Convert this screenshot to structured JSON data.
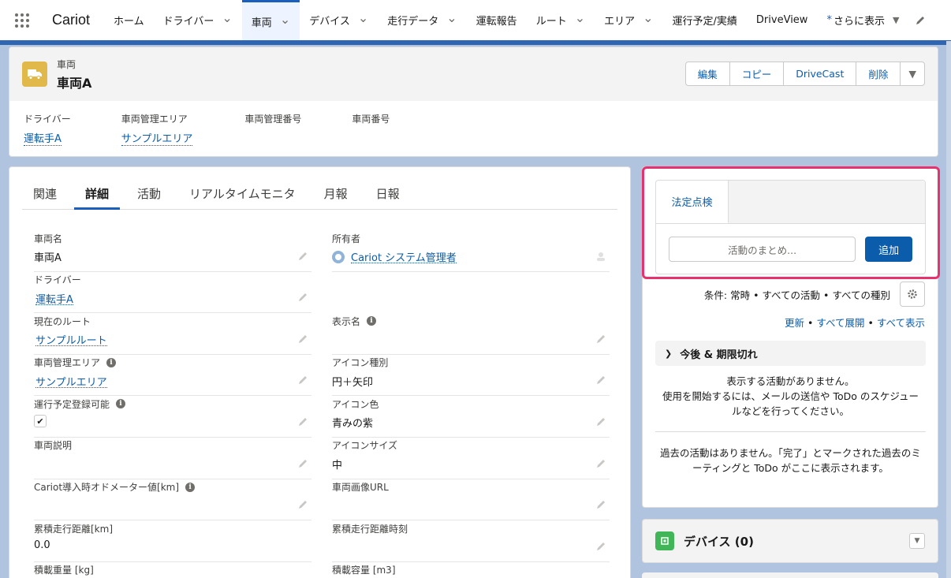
{
  "nav": {
    "app_name": "Cariot",
    "items": [
      {
        "label": "ホーム",
        "chevron": false,
        "active": false
      },
      {
        "label": "ドライバー",
        "chevron": true,
        "active": false
      },
      {
        "label": "車両",
        "chevron": true,
        "active": true
      },
      {
        "label": "デバイス",
        "chevron": true,
        "active": false
      },
      {
        "label": "走行データ",
        "chevron": true,
        "active": false
      },
      {
        "label": "運転報告",
        "chevron": false,
        "active": false
      },
      {
        "label": "ルート",
        "chevron": true,
        "active": false
      },
      {
        "label": "エリア",
        "chevron": true,
        "active": false
      },
      {
        "label": "運行予定/実績",
        "chevron": false,
        "active": false
      },
      {
        "label": "DriveView",
        "chevron": false,
        "active": false
      }
    ],
    "more_label": "さらに表示",
    "more_star": "*"
  },
  "record": {
    "object_label": "車両",
    "name": "車両A",
    "icon_color": "#e0b94a",
    "actions": [
      "編集",
      "コピー",
      "DriveCast",
      "削除"
    ],
    "highlights": [
      {
        "label": "ドライバー",
        "value": "運転手A"
      },
      {
        "label": "車両管理エリア",
        "value": "サンプルエリア"
      },
      {
        "label": "車両管理番号",
        "value": ""
      },
      {
        "label": "車両番号",
        "value": ""
      }
    ]
  },
  "detail": {
    "tabs": [
      "関連",
      "詳細",
      "活動",
      "リアルタイムモニタ",
      "月報",
      "日報"
    ],
    "active_tab": "詳細",
    "fields": {
      "vehicle_name": {
        "label": "車両名",
        "value": "車両A"
      },
      "owner": {
        "label": "所有者",
        "value": "Cariot システム管理者"
      },
      "driver": {
        "label": "ドライバー",
        "value": "運転手A"
      },
      "current_route": {
        "label": "現在のルート",
        "value": "サンプルルート"
      },
      "display_name": {
        "label": "表示名",
        "value": ""
      },
      "area": {
        "label": "車両管理エリア",
        "value": "サンプルエリア"
      },
      "icon_type": {
        "label": "アイコン種別",
        "value": "円＋矢印"
      },
      "schedulable": {
        "label": "運行予定登録可能",
        "checked": true
      },
      "icon_color": {
        "label": "アイコン色",
        "value": "青みの紫"
      },
      "vehicle_desc": {
        "label": "車両説明",
        "value": ""
      },
      "icon_size": {
        "label": "アイコンサイズ",
        "value": "中"
      },
      "odometer": {
        "label": "Cariot導入時オドメーター値[km]",
        "value": ""
      },
      "image_url": {
        "label": "車両画像URL",
        "value": ""
      },
      "total_distance": {
        "label": "累積走行距離[km]",
        "value": "0.0"
      },
      "total_distance_time": {
        "label": "累積走行距離時刻",
        "value": ""
      },
      "load_weight": {
        "label": "積載重量 [kg]",
        "value": ""
      },
      "load_capacity": {
        "label": "積載容量 [m3]",
        "value": ""
      }
    }
  },
  "activity": {
    "composer_tab": "法定点検",
    "input_placeholder": "活動のまとめ...",
    "add_button": "追加",
    "filter_text": "条件: 常時 • すべての活動 • すべての種別",
    "links": {
      "refresh": "更新",
      "expand_all": "すべて展開",
      "show_all": "すべて表示",
      "separator": " • "
    },
    "upcoming_title": "今後 & 期限切れ",
    "empty_upcoming": "表示する活動がありません。\n使用を開始するには、メールの送信や ToDo のスケジュールなどを行ってください。",
    "empty_past": "過去の活動はありません。「完了」とマークされた過去のミーティングと ToDo がここに表示されます。",
    "highlight_color": "#e8326e"
  },
  "related": {
    "devices_title": "デバイス (0)",
    "devices_icon_color": "#41b658"
  }
}
